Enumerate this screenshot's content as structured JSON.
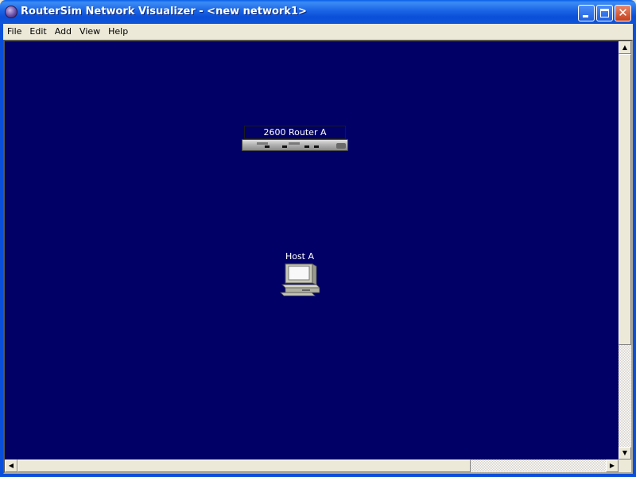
{
  "window": {
    "title": "RouterSim Network Visualizer - <new network1>",
    "app_icon": "routersim-app-icon",
    "minimize_label": "",
    "maximize_label": "",
    "close_label": "✕"
  },
  "menu": {
    "items": [
      {
        "label": "File"
      },
      {
        "label": "Edit"
      },
      {
        "label": "Add"
      },
      {
        "label": "View"
      },
      {
        "label": "Help"
      }
    ]
  },
  "canvas": {
    "background_color": "#000066",
    "devices": [
      {
        "type": "router",
        "label": "2600 Router A",
        "icon": "router-icon"
      },
      {
        "type": "host",
        "label": "Host A",
        "icon": "computer-icon"
      }
    ]
  },
  "scrollbars": {
    "up_arrow": "▲",
    "down_arrow": "▼",
    "left_arrow": "◀",
    "right_arrow": "▶"
  }
}
